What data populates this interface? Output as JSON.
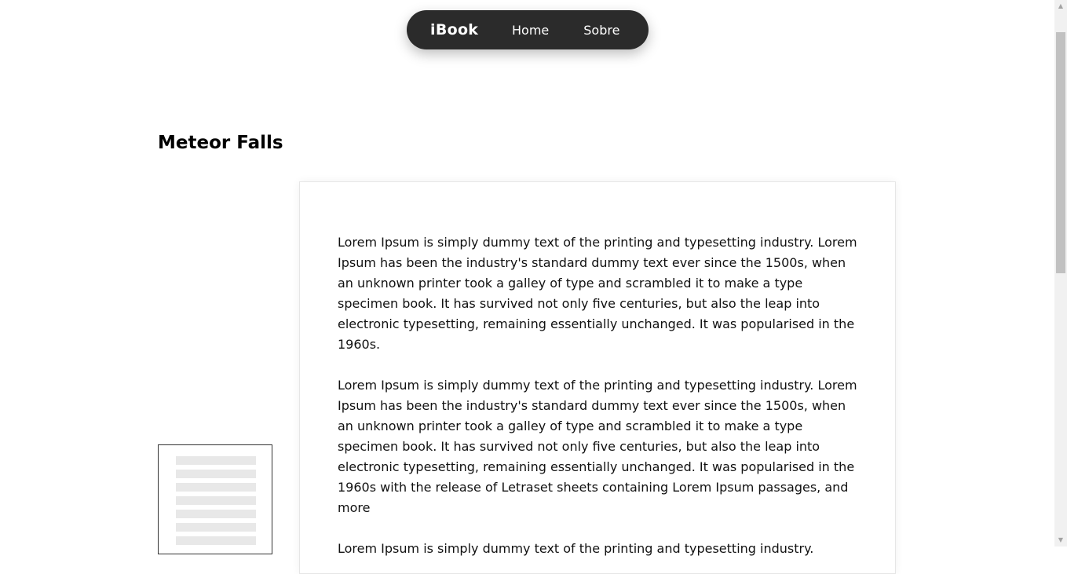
{
  "nav": {
    "brand": "iBook",
    "links": [
      "Home",
      "Sobre"
    ]
  },
  "page": {
    "title": "Meteor Falls"
  },
  "content": {
    "paragraphs": [
      "Lorem Ipsum is simply dummy text of the printing and typesetting industry. Lorem Ipsum has been the industry's standard dummy text ever since the 1500s, when an unknown printer took a galley of type and scrambled it to make a type specimen book. It has survived not only five centuries, but also the leap into electronic typesetting, remaining essentially unchanged. It was popularised in the 1960s.",
      "Lorem Ipsum is simply dummy text of the printing and typesetting industry. Lorem Ipsum has been the industry's standard dummy text ever since the 1500s, when an unknown printer took a galley of type and scrambled it to make a type specimen book. It has survived not only five centuries, but also the leap into electronic typesetting, remaining essentially unchanged. It was popularised in the 1960s with the release of Letraset sheets containing Lorem Ipsum passages, and more",
      "Lorem Ipsum is simply dummy text of the printing and typesetting industry."
    ]
  },
  "icons": {
    "scroll_up": "triangle-up-icon",
    "scroll_down": "triangle-down-icon"
  }
}
